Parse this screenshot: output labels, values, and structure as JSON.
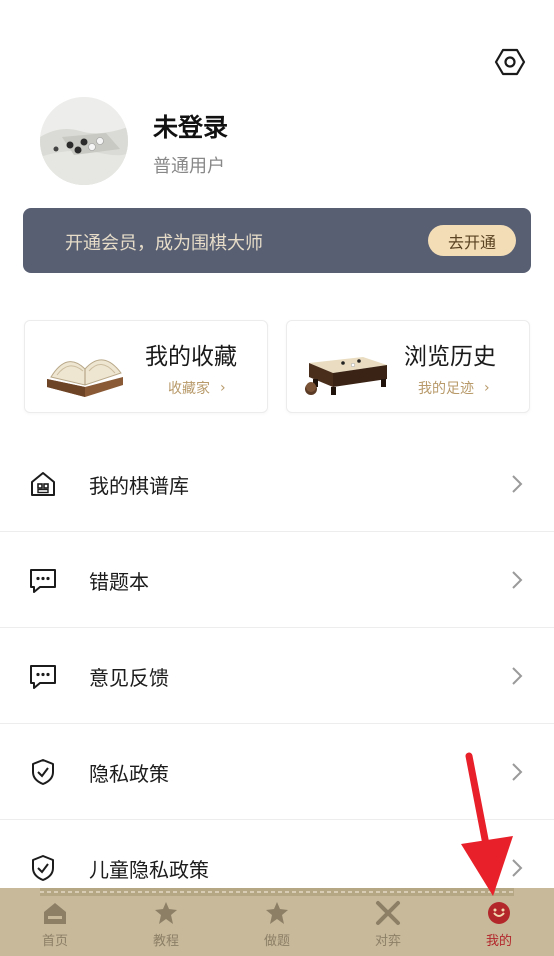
{
  "header": {
    "settings_icon": "settings-hexagon-icon"
  },
  "user": {
    "name": "未登录",
    "level": "普通用户"
  },
  "vip": {
    "text": "开通会员，成为围棋大师",
    "button_label": "去开通",
    "background_color": "#585f73",
    "button_color": "#f3ddb7"
  },
  "cards": {
    "favorites": {
      "title": "我的收藏",
      "subtitle": "收藏家"
    },
    "history": {
      "title": "浏览历史",
      "subtitle": "我的足迹"
    }
  },
  "menu": {
    "items": [
      {
        "label": "我的棋谱库",
        "icon": "house-icon"
      },
      {
        "label": "错题本",
        "icon": "chat-bubble-icon"
      },
      {
        "label": "意见反馈",
        "icon": "chat-bubble-icon"
      },
      {
        "label": "隐私政策",
        "icon": "shield-check-icon"
      },
      {
        "label": "儿童隐私政策",
        "icon": "shield-check-icon"
      }
    ]
  },
  "tabbar": {
    "background_color": "#c7b99a",
    "active_color": "#b3272b",
    "tabs": [
      {
        "label": "首页",
        "icon": "home-icon",
        "active": false
      },
      {
        "label": "教程",
        "icon": "tutorial-star-icon",
        "active": false
      },
      {
        "label": "做题",
        "icon": "exercise-star-icon",
        "active": false
      },
      {
        "label": "对弈",
        "icon": "crossed-swords-icon",
        "active": false
      },
      {
        "label": "我的",
        "icon": "profile-icon",
        "active": true
      }
    ]
  }
}
